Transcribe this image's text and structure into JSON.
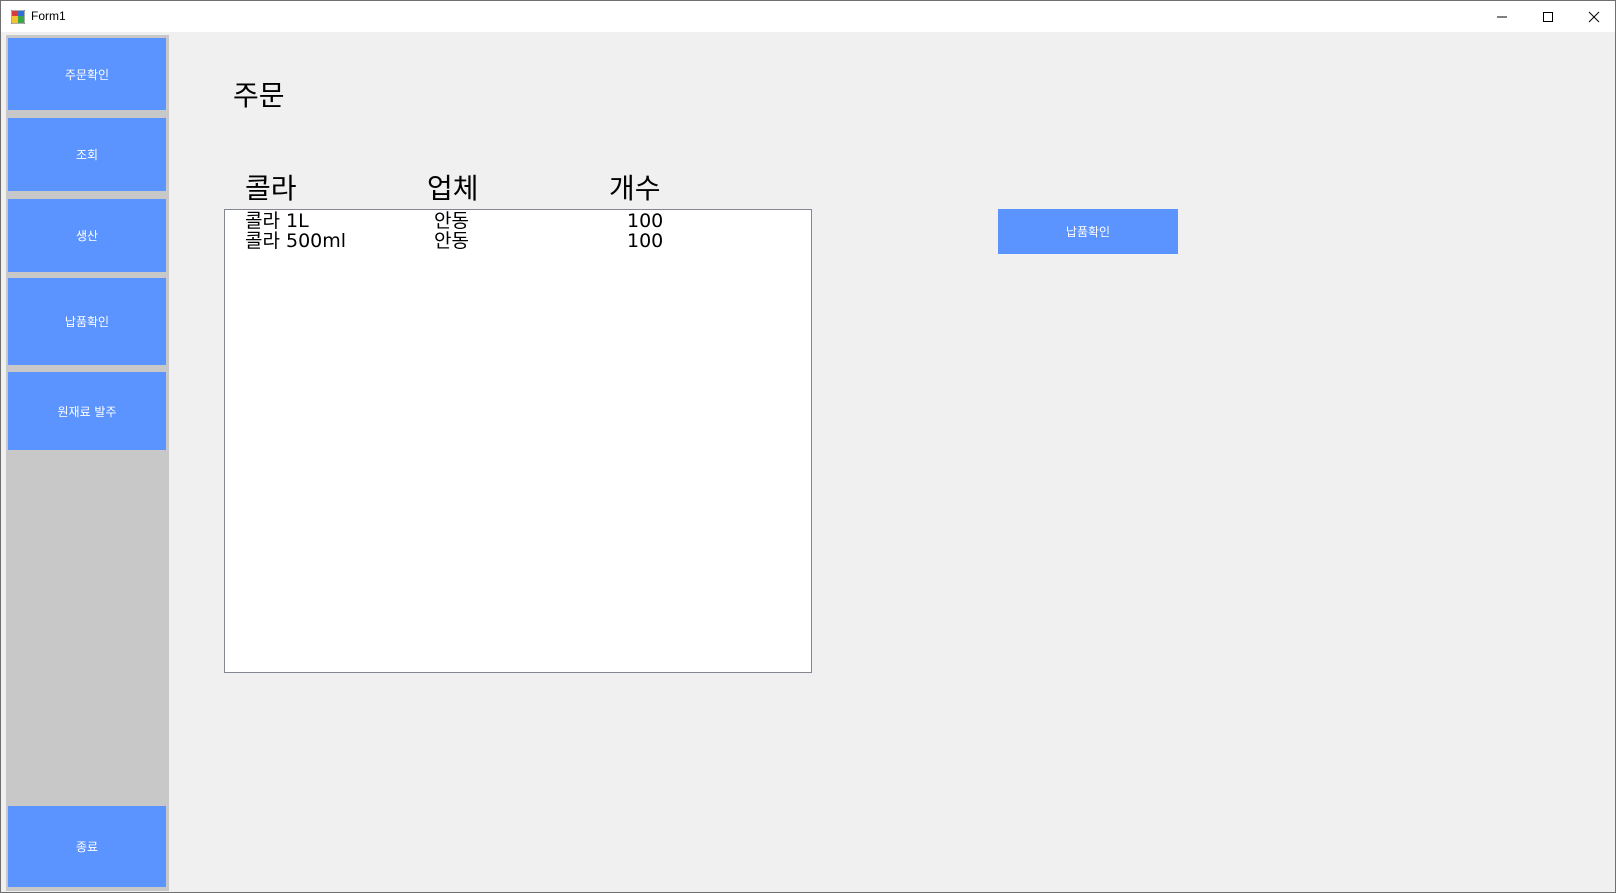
{
  "window": {
    "title": "Form1"
  },
  "sidebar": {
    "items": [
      {
        "label": "주문확인"
      },
      {
        "label": "조회"
      },
      {
        "label": "생산"
      },
      {
        "label": "납품확인"
      },
      {
        "label": "원재료 발주"
      }
    ],
    "exit_label": "종료"
  },
  "main": {
    "title": "주문",
    "columns": [
      "콜라",
      "업체",
      "개수"
    ],
    "rows": [
      [
        "콜라 1L",
        "안동",
        "100"
      ],
      [
        "콜라 500ml",
        "안동",
        "100"
      ]
    ],
    "action_button": "납품확인"
  },
  "colors": {
    "accent": "#5b93ff",
    "sidebar_bg": "#c8c8c8",
    "form_bg": "#f0f0f0"
  },
  "icons": [
    "app-icon",
    "minimize-icon",
    "maximize-icon",
    "close-icon"
  ]
}
